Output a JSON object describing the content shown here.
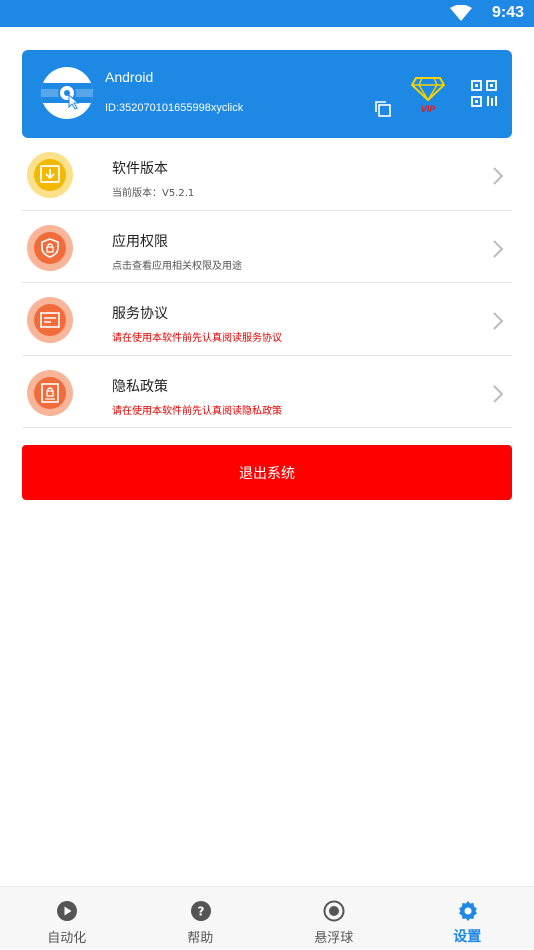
{
  "status_bar": {
    "time": "9:43"
  },
  "profile": {
    "name": "Android",
    "device_id": "ID:352070101655998xyclick",
    "vip_label": "VIP"
  },
  "menu": [
    {
      "title": "软件版本",
      "subtitle": "当前版本：V5.2.1",
      "icon": "download-icon",
      "icon_color": "#F5B800"
    },
    {
      "title": "应用权限",
      "subtitle": "点击查看应用相关权限及用途",
      "icon": "shield-lock-icon",
      "icon_color": "#F26B3A"
    },
    {
      "title": "服务协议",
      "subtitle": "请在使用本软件前先认真阅读服务协议",
      "icon": "document-icon",
      "icon_color": "#F26B3A"
    },
    {
      "title": "隐私政策",
      "subtitle": "请在使用本软件前先认真阅读隐私政策",
      "icon": "lock-document-icon",
      "icon_color": "#F26B3A"
    }
  ],
  "logout_label": "退出系统",
  "tabs": [
    {
      "label": "自动化",
      "icon": "play-icon"
    },
    {
      "label": "帮助",
      "icon": "help-icon"
    },
    {
      "label": "悬浮球",
      "icon": "radio-icon"
    },
    {
      "label": "设置",
      "icon": "gear-icon",
      "active": true
    }
  ],
  "colors": {
    "primary": "#1E88E5",
    "danger": "#FF0000",
    "subtitle_red": "#E10000"
  }
}
